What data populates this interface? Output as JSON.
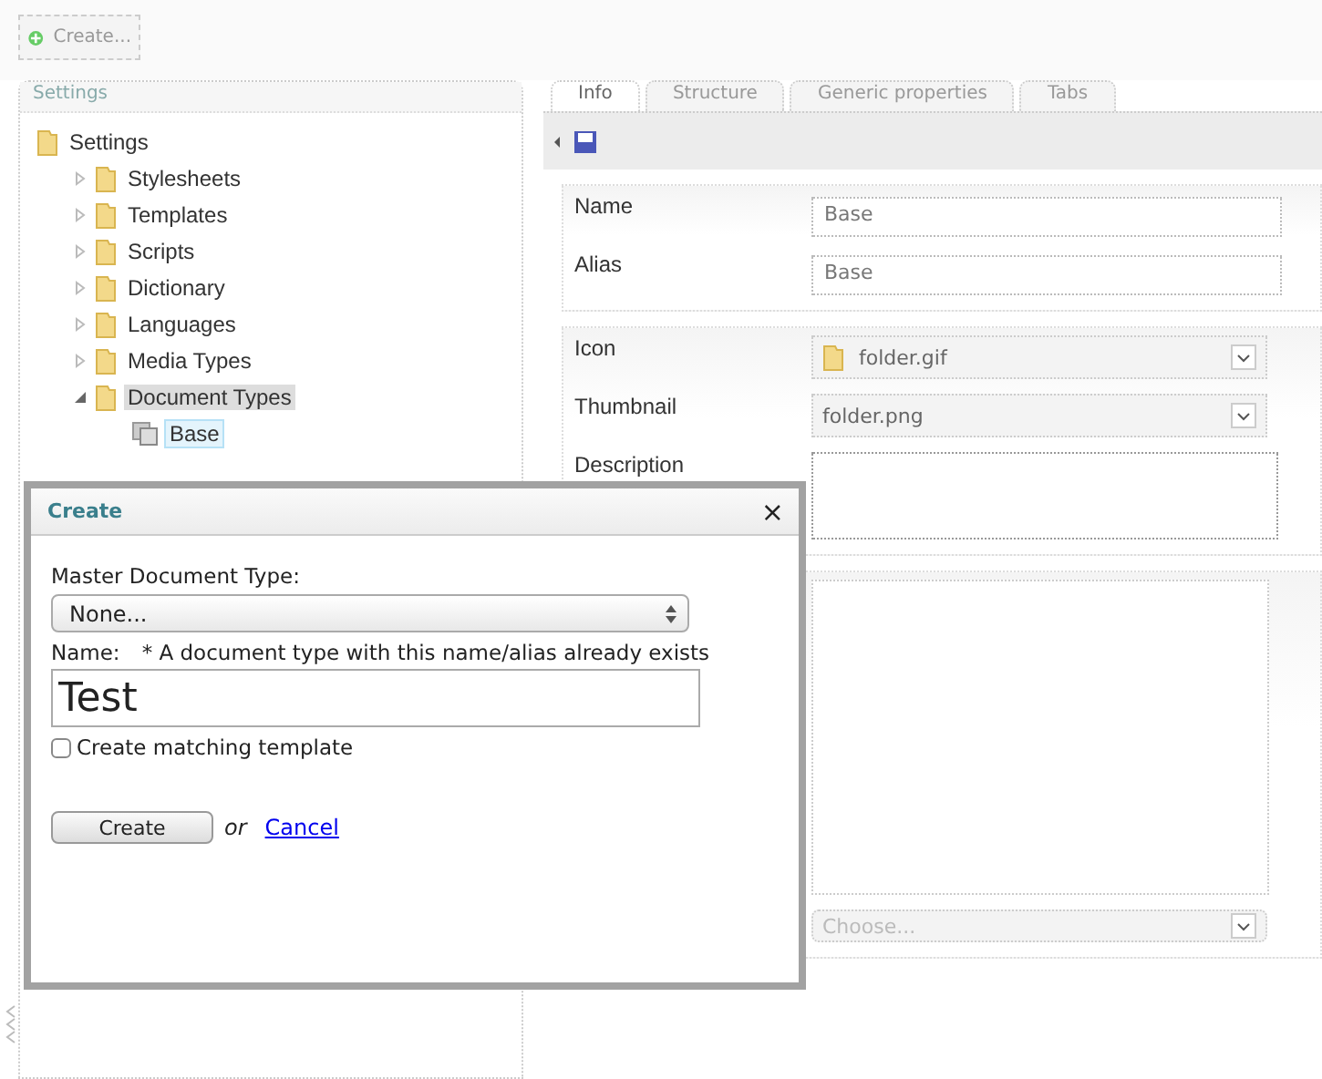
{
  "toolbar": {
    "create_button": "Create..."
  },
  "sidebar": {
    "title": "Settings",
    "tree": [
      {
        "label": "Settings",
        "kind": "folder",
        "selected": false,
        "highlighted": false,
        "children": [
          {
            "label": "Stylesheets",
            "kind": "folder",
            "expanded": false,
            "selected": false,
            "highlighted": false
          },
          {
            "label": "Templates",
            "kind": "folder",
            "expanded": false,
            "selected": false,
            "highlighted": false
          },
          {
            "label": "Scripts",
            "kind": "folder",
            "expanded": false,
            "selected": false,
            "highlighted": false
          },
          {
            "label": "Dictionary",
            "kind": "folder",
            "expanded": false,
            "selected": false,
            "highlighted": false
          },
          {
            "label": "Languages",
            "kind": "folder",
            "expanded": false,
            "selected": false,
            "highlighted": false
          },
          {
            "label": "Media Types",
            "kind": "folder",
            "expanded": false,
            "selected": false,
            "highlighted": false
          },
          {
            "label": "Document Types",
            "kind": "folder",
            "expanded": true,
            "selected": false,
            "highlighted": true,
            "children": [
              {
                "label": "Base",
                "kind": "document_type",
                "selected": true,
                "highlighted": false
              }
            ]
          }
        ]
      }
    ]
  },
  "editor": {
    "tabs": [
      {
        "label": "Info",
        "selected": true
      },
      {
        "label": "Structure",
        "selected": false
      },
      {
        "label": "Generic properties",
        "selected": false
      },
      {
        "label": "Tabs",
        "selected": false
      }
    ],
    "groups": [
      {
        "fields": [
          {
            "label": "Name",
            "kind": "text",
            "value": "Base"
          },
          {
            "label": "Alias",
            "kind": "text",
            "value": "Base"
          }
        ]
      },
      {
        "fields": [
          {
            "label": "Icon",
            "kind": "icon_select",
            "value": "folder.gif"
          },
          {
            "label": "Thumbnail",
            "kind": "select",
            "value": "folder.png"
          },
          {
            "label": "Description",
            "kind": "textarea"
          }
        ]
      },
      {
        "fields": [
          {
            "kind": "large_textarea"
          },
          {
            "kind": "select",
            "value": "Choose..."
          }
        ]
      }
    ]
  },
  "dialog": {
    "title": "Create",
    "close": "×",
    "master_label": "Master Document Type:",
    "master_value": "None...",
    "name_label": "Name:",
    "error": "* A document type with this name/alias already exists",
    "name_value": "Test",
    "template_checkbox": {
      "label": "Create matching template",
      "checked": false
    },
    "create_button": "Create",
    "or": "or",
    "cancel_link": "Cancel"
  }
}
